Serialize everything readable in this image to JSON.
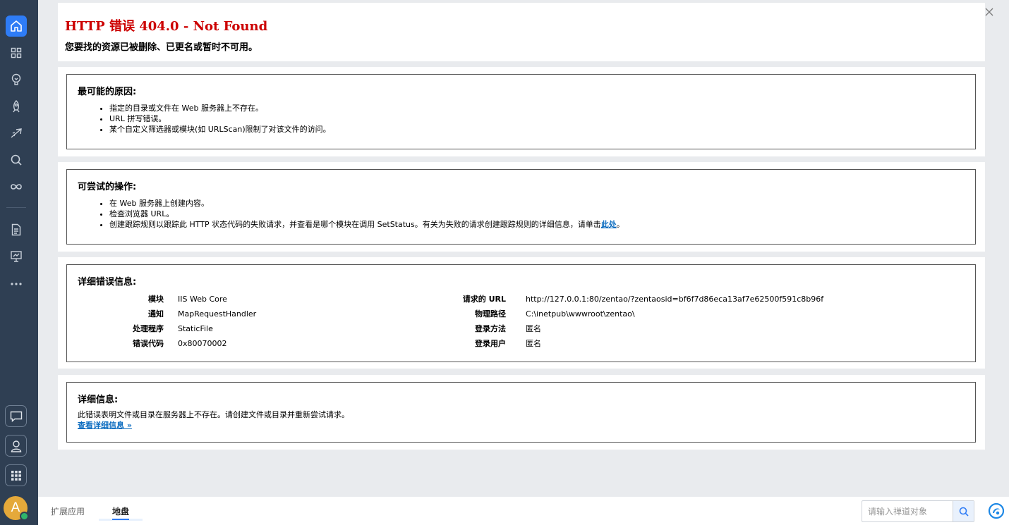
{
  "sidebar": {
    "icons": [
      "home-icon",
      "grid-icon",
      "lightbulb-icon",
      "rocket-icon",
      "flight-icon",
      "search-icon",
      "infinity-icon",
      "document-icon",
      "presentation-icon",
      "more-icon",
      "chat-icon",
      "user-icon",
      "apps-icon"
    ],
    "avatar_letter": "A",
    "accent": "#2e7cf6"
  },
  "window_controls": [
    "minimize-icon",
    "maximize-icon",
    "close-icon"
  ],
  "header": {
    "title": "HTTP 错误 404.0 - Not Found",
    "subtitle": "您要找的资源已被删除、已更名或暂时不可用。"
  },
  "causes": {
    "heading": "最可能的原因:",
    "items": [
      "指定的目录或文件在 Web 服务器上不存在。",
      "URL 拼写错误。",
      "某个自定义筛选器或模块(如 URLScan)限制了对该文件的访问。"
    ]
  },
  "actions": {
    "heading": "可尝试的操作:",
    "items": [
      "在 Web 服务器上创建内容。",
      "检查浏览器 URL。"
    ],
    "last_item_prefix": "创建跟踪规则以跟踪此 HTTP 状态代码的失败请求，并查看是哪个模块在调用 SetStatus。有关为失败的请求创建跟踪规则的详细信息，请单击",
    "last_item_link": "此处",
    "last_item_suffix": "。"
  },
  "error_info": {
    "heading": "详细错误信息:",
    "left": [
      {
        "key": "模块",
        "value": "IIS Web Core"
      },
      {
        "key": "通知",
        "value": "MapRequestHandler"
      },
      {
        "key": "处理程序",
        "value": "StaticFile"
      },
      {
        "key": "错误代码",
        "value": "0x80070002"
      }
    ],
    "right": [
      {
        "key": "请求的 URL",
        "value": "http://127.0.0.1:80/zentao/?zentaosid=bf6f7d86eca13af7e62500f591c8b96f"
      },
      {
        "key": "物理路径",
        "value": "C:\\inetpub\\wwwroot\\zentao\\"
      },
      {
        "key": "登录方法",
        "value": "匿名"
      },
      {
        "key": "登录用户",
        "value": "匿名"
      }
    ]
  },
  "more_info": {
    "heading": "详细信息:",
    "text": "此错误表明文件或目录在服务器上不存在。请创建文件或目录并重新尝试请求。",
    "link": "查看详细信息 »"
  },
  "bottombar": {
    "tabs": [
      "扩展应用",
      "地盘"
    ],
    "active_tab": "地盘",
    "search_placeholder": "请输入禅道对象"
  }
}
